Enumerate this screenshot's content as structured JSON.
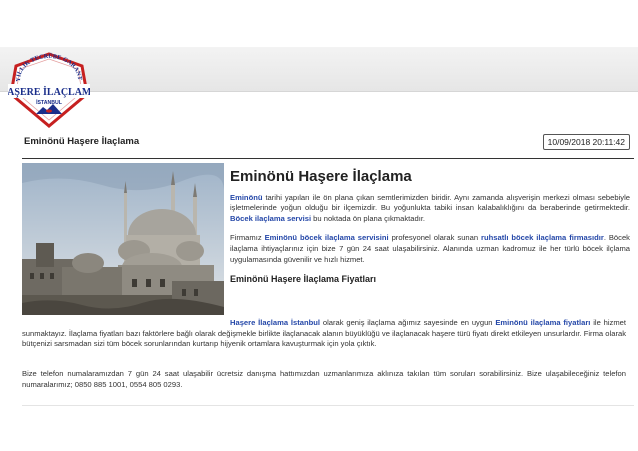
{
  "logo": {
    "arc_text": "15 YILLIK TECRÜBE GARANTİLİ",
    "brand": "HAŞERE İLAÇLAMA",
    "city": "İSTANBUL",
    "colors": {
      "border": "#c62020",
      "text": "#1a2e8a",
      "plate": "#ffffff"
    }
  },
  "header": {
    "title": "Eminönü Haşere İlaçlama",
    "datetime": "10/09/2018 20:11:42"
  },
  "photo": {
    "icon": "mosque-photo"
  },
  "article": {
    "heading": "Eminönü Haşere İlaçlama",
    "p1": {
      "lead": "Eminönü",
      "text": " tarihi yapıları ile ön plana çıkan semtlerimizden biridir. Aynı zamanda alışverişin merkezi olması sebebiyle işletmelerinde yoğun olduğu bir ilçemizdir. Bu yoğunlukta tabiki insan kalabalıklığını da beraberinde getirmektedir. ",
      "link": "Böcek ilaçlama servisi",
      "tail": " bu noktada ön plana çıkmaktadır."
    },
    "p2": {
      "pre": "Firmamız ",
      "link1": "Eminönü böcek ilaçlama servisini",
      "mid": " profesyonel olarak sunan ",
      "link2": "ruhsatlı böcek ilaçlama firmasıdır",
      "tail": ". Böcek ilaçlama ihtiyaçlarınız için bize 7 gün 24 saat ulaşabilirsiniz. Alanında uzman kadromuz ile her türlü böcek ilçlama uygulamasında güvenilir ve hızlı hizmet."
    },
    "subheading": "Eminönü Haşere İlaçlama Fiyatları",
    "p3": {
      "link1": "Haşere İlaçlama İstanbul",
      "mid": " olarak geniş ilaçlama ağımız sayesinde en uygun ",
      "link2": "Eminönü ilaçlama fiyatları",
      "tail": " ile hizmet sunmaktayız. İlaçlama fiyatları bazı faktörlere bağlı olarak değişmekle birlikte ilaçlanacak alanın büyüklüğü ve ilaçlanacak haşere türü fiyatı direkt etkileyen unsurlardır. Firma olarak bütçenizi sarsmadan sizi tüm böcek sorunlarından kurtarıp hijyenik ortamlara kavuşturmak için yola çıktık."
    },
    "p4": "Bize telefon numalaramızdan 7 gün 24 saat ulaşabilir ücretsiz danışma hattımızdan uzmanlarımıza aklınıza takılan tüm soruları sorabilirsiniz. Bize ulaşabileceğiniz telefon numaralarımız; 0850 885 1001, 0554 805 0293."
  },
  "colors": {
    "link": "#2447a8",
    "rule": "#333333"
  }
}
